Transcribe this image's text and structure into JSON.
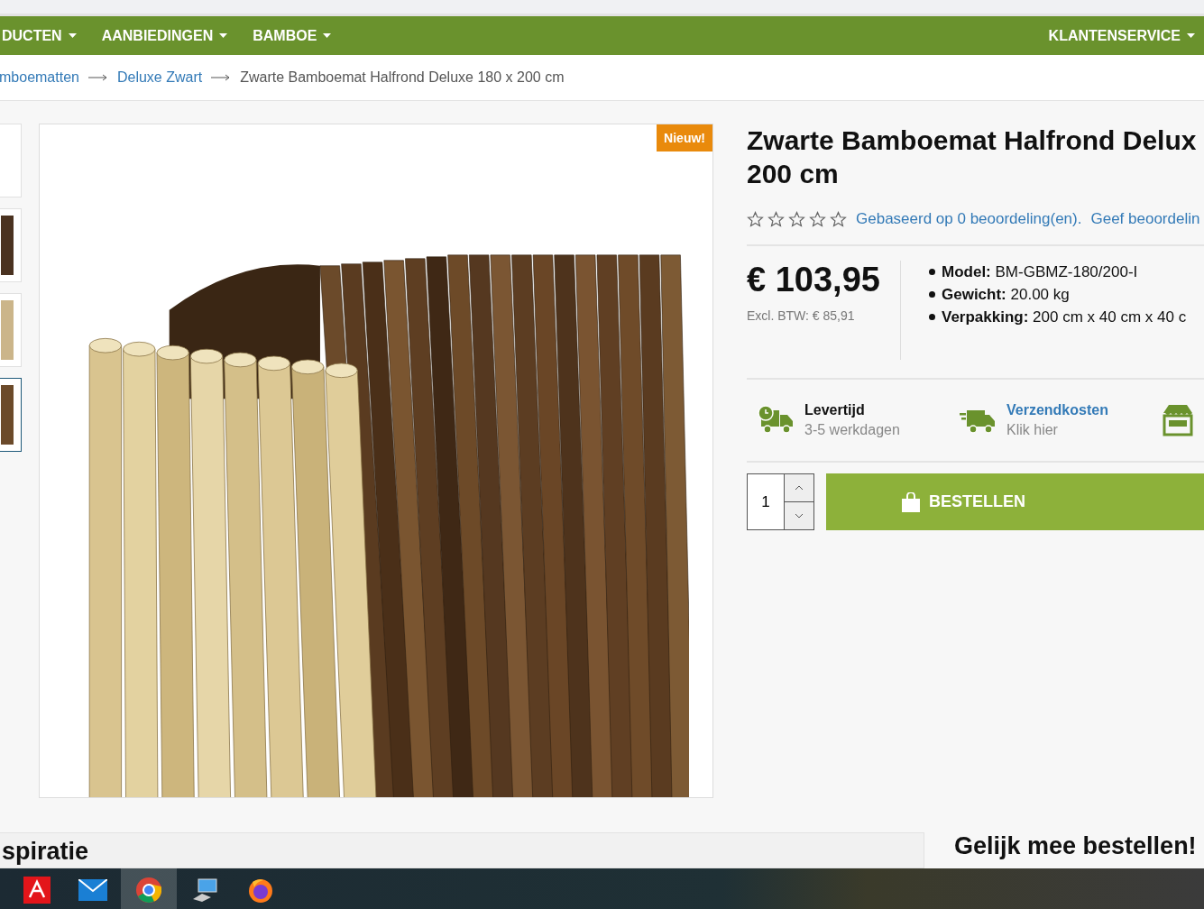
{
  "nav": {
    "items": [
      {
        "label": "DUCTEN"
      },
      {
        "label": "AANBIEDINGEN"
      },
      {
        "label": "BAMBOE"
      }
    ],
    "right_item": {
      "label": "KLANTENSERVICE"
    }
  },
  "breadcrumb": {
    "links": [
      "mboematten",
      "Deluxe Zwart"
    ],
    "current": "Zwarte Bamboemat Halfrond Deluxe 180 x 200 cm"
  },
  "gallery": {
    "thumbnails": [
      {
        "selected": false
      },
      {
        "selected": false
      },
      {
        "selected": false
      },
      {
        "selected": true
      }
    ],
    "badge": "Nieuw!"
  },
  "product": {
    "title_lines": [
      "Zwarte Bamboemat Halfrond Delux",
      "200 cm"
    ],
    "rating": {
      "stars": 0,
      "summary": "Gebaseerd op 0 beoordeling(en).",
      "write_link": "Geef beoordelin"
    },
    "price": "€ 103,95",
    "price_excl": "Excl. BTW: € 85,91",
    "specs": [
      {
        "label": "Model:",
        "value": "BM-GBMZ-180/200-I"
      },
      {
        "label": "Gewicht:",
        "value": "20.00 kg"
      },
      {
        "label": "Verpakking:",
        "value": "200 cm x 40 cm x 40 c"
      }
    ],
    "info": [
      {
        "kind": "delivery",
        "title": "Levertijd",
        "subtitle": "3-5 werkdagen"
      },
      {
        "kind": "shipping",
        "title": "Verzendkosten",
        "subtitle": "Klik hier"
      },
      {
        "kind": "shop"
      }
    ],
    "quantity": "1",
    "order_button": "BESTELLEN"
  },
  "bottom": {
    "left_heading": "spiratie",
    "right_heading": "Gelijk mee bestellen!"
  },
  "taskbar": {
    "apps": [
      {
        "kind": "pdf",
        "selected": false
      },
      {
        "kind": "mail",
        "selected": false
      },
      {
        "kind": "chrome",
        "selected": true
      },
      {
        "kind": "computer",
        "selected": false
      },
      {
        "kind": "firefox",
        "selected": false
      }
    ]
  }
}
